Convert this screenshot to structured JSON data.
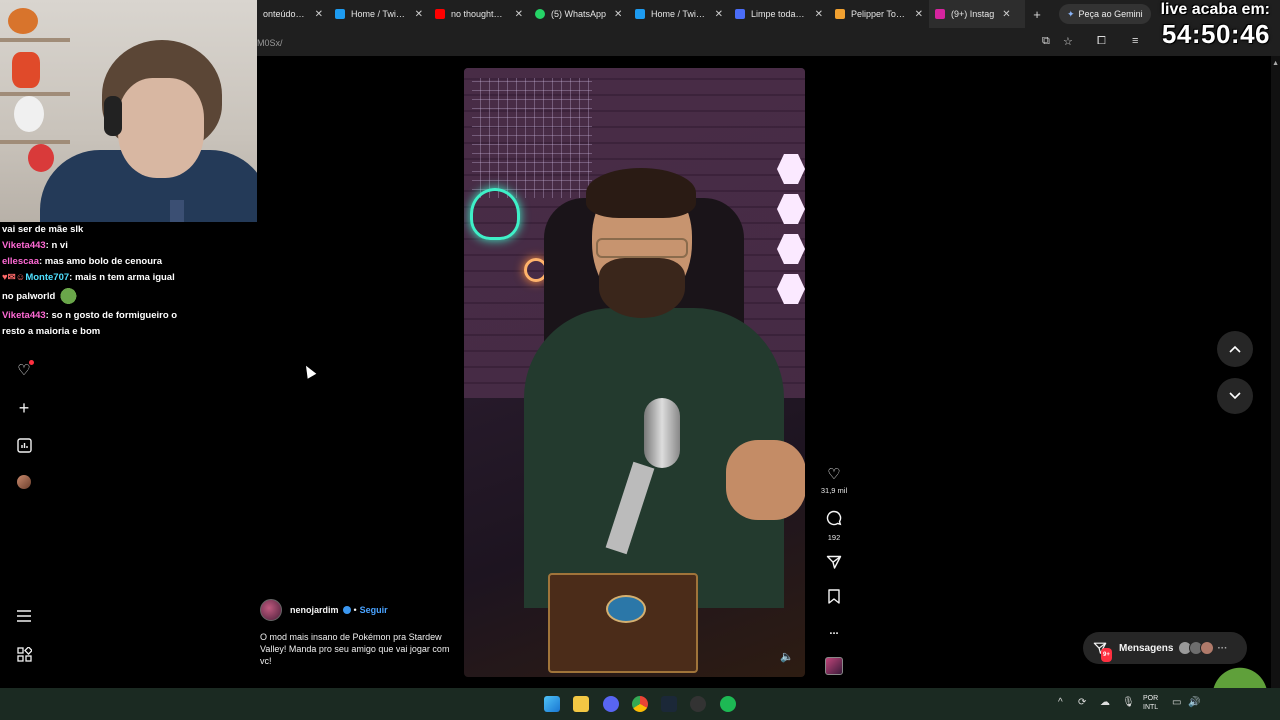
{
  "browser": {
    "tabs": [
      {
        "label": "onteúdo do c",
        "icon_color": "#333333"
      },
      {
        "label": "Home / Twitter",
        "icon_color": "#1d9bf0"
      },
      {
        "label": "no thoughts, h",
        "icon_color": "#ff0000"
      },
      {
        "label": "(5) WhatsApp",
        "icon_color": "#25d366"
      },
      {
        "label": "Home / Twitter",
        "icon_color": "#1d9bf0"
      },
      {
        "label": "Limpe todas a",
        "icon_color": "#4a6cf7"
      },
      {
        "label": "Pelipper Town",
        "icon_color": "#f0a030"
      },
      {
        "label": "(9+) Instag",
        "icon_color": "#d6249f"
      }
    ],
    "new_tab": "+",
    "gemini_label": "Peça ao Gemini",
    "url": "M0Sx/"
  },
  "stream": {
    "timer_label": "live acaba em:",
    "timer_value": "54:50:46"
  },
  "chat": [
    {
      "user": "",
      "user_color": "#ffffff",
      "text": "vai ser de mãe slk"
    },
    {
      "user": "Viketa443",
      "user_color": "#ff6ad5",
      "text": ": n vi"
    },
    {
      "user": "ellescaa",
      "user_color": "#ff6ad5",
      "text": ": mas amo bolo de cenoura"
    },
    {
      "user": "Monte707",
      "user_color": "#4fe0ff",
      "text": ": mais n tem arma igual",
      "prefix": "♥✉☺"
    },
    {
      "user": "",
      "user_color": "#ffffff",
      "text": "no palworld",
      "emote": true
    },
    {
      "user": "Viketa443",
      "user_color": "#ff6ad5",
      "text": ": so n gosto de formigueiro o"
    },
    {
      "user": "",
      "user_color": "#ffffff",
      "text": "resto a maioria e bom"
    }
  ],
  "nav": {
    "notifications_icon": "heart-icon",
    "create_icon": "plus-icon",
    "dashboard_icon": "chart-icon",
    "menu_icon": "hamburger-icon",
    "more_icon": "grid-icon"
  },
  "reel": {
    "author": "nenojardim",
    "follow_label": "Seguir",
    "separator": "•",
    "caption": "O mod mais insano de Pokémon pra Stardew Valley! Manda pro seu amigo que vai jogar com vc!",
    "likes": "31,9 mil",
    "comments": "192",
    "more": "..."
  },
  "messages": {
    "label": "Mensagens",
    "badge": "9+",
    "more": "···"
  },
  "taskbar": {
    "lang_line1": "POR",
    "lang_line2": "INTL"
  },
  "colors": {
    "background": "#000000",
    "accent_follow": "#4aa3ff",
    "notification_red": "#ff3040"
  }
}
